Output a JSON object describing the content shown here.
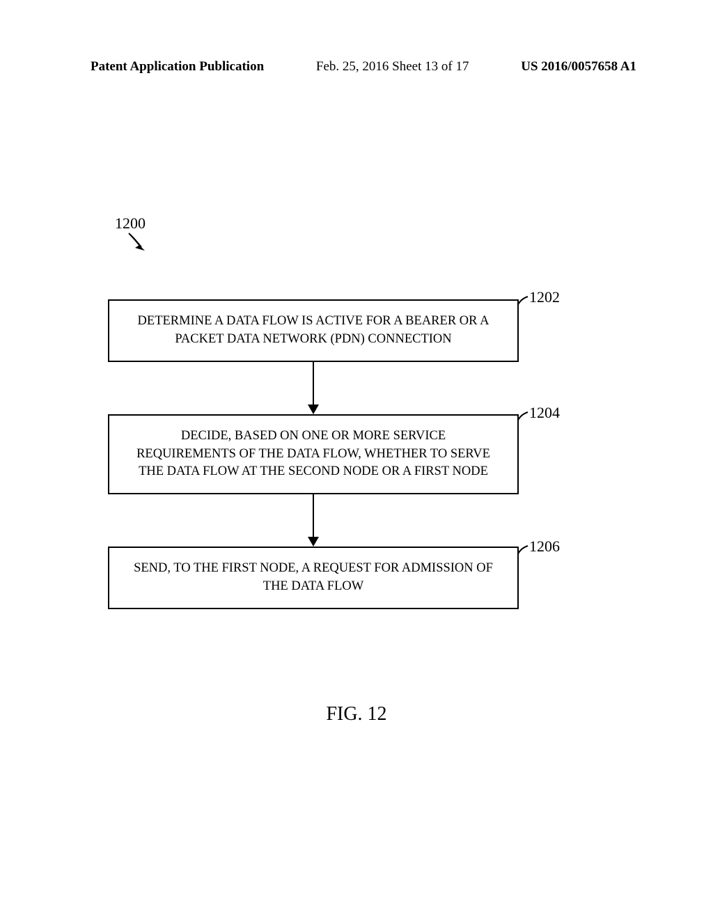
{
  "header": {
    "left": "Patent Application Publication",
    "center": "Feb. 25, 2016  Sheet 13 of 17",
    "right": "US 2016/0057658 A1"
  },
  "flowchart": {
    "main_ref": "1200",
    "steps": [
      {
        "ref": "1202",
        "text": "DETERMINE A DATA FLOW IS ACTIVE FOR A BEARER OR A PACKET DATA NETWORK (PDN) CONNECTION"
      },
      {
        "ref": "1204",
        "text": "DECIDE, BASED ON ONE OR MORE SERVICE REQUIREMENTS OF THE DATA FLOW, WHETHER TO SERVE THE DATA FLOW AT THE SECOND NODE OR A FIRST NODE"
      },
      {
        "ref": "1206",
        "text": "SEND, TO THE FIRST NODE, A REQUEST FOR ADMISSION OF THE DATA FLOW"
      }
    ]
  },
  "figure_caption": "FIG. 12",
  "chart_data": {
    "type": "flowchart",
    "title": "FIG. 12",
    "reference": "1200",
    "nodes": [
      {
        "id": "1202",
        "label": "DETERMINE A DATA FLOW IS ACTIVE FOR A BEARER OR A PACKET DATA NETWORK (PDN) CONNECTION"
      },
      {
        "id": "1204",
        "label": "DECIDE, BASED ON ONE OR MORE SERVICE REQUIREMENTS OF THE DATA FLOW, WHETHER TO SERVE THE DATA FLOW AT THE SECOND NODE OR A FIRST NODE"
      },
      {
        "id": "1206",
        "label": "SEND, TO THE FIRST NODE, A REQUEST FOR ADMISSION OF THE DATA FLOW"
      }
    ],
    "edges": [
      {
        "from": "1202",
        "to": "1204"
      },
      {
        "from": "1204",
        "to": "1206"
      }
    ]
  }
}
